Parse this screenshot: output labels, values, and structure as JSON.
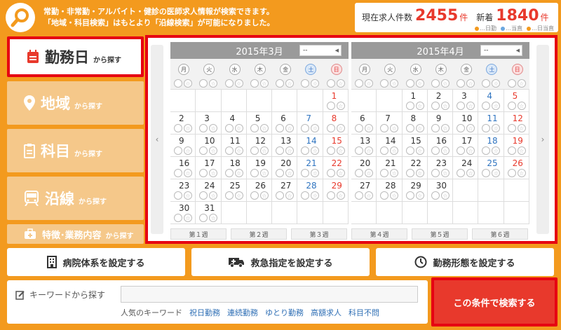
{
  "header": {
    "line1": "常勤・非常勤・アルバイト・健診の医師求人情報が検索できます。",
    "line2": "「地域・科目検索」はもとより「沿線検索」が可能になりました。",
    "total_label": "現在求人件数",
    "total_value": "2455",
    "total_unit": "件",
    "new_label": "新着",
    "new_value": "1840",
    "new_unit": "件",
    "legend": [
      "…日勤",
      "…当直",
      "…日当直"
    ]
  },
  "tabs": [
    {
      "big": "勤務日",
      "small": "から探す",
      "icon": "calendar-icon"
    },
    {
      "big": "地域",
      "small": "から探す",
      "icon": "map-pin-icon"
    },
    {
      "big": "科目",
      "small": "から探す",
      "icon": "clipboard-icon"
    },
    {
      "big": "沿線",
      "small": "から探す",
      "icon": "train-icon"
    },
    {
      "big": "特徴･業務内容",
      "small": "から探す",
      "icon": "briefcase-icon"
    }
  ],
  "calendar": {
    "weekdays": [
      "月",
      "火",
      "水",
      "木",
      "金",
      "土",
      "日"
    ],
    "months": [
      {
        "title": "2015年3月",
        "select": "--",
        "offset": 6,
        "days": 31
      },
      {
        "title": "2015年4月",
        "select": "--",
        "offset": 2,
        "days": 30
      }
    ],
    "weeks_left": [
      "第１週",
      "第２週",
      "第３週"
    ],
    "weeks_right": [
      "第４週",
      "第５週",
      "第６週"
    ]
  },
  "options": [
    {
      "label": "病院体系を設定する",
      "icon": "building-icon"
    },
    {
      "label": "救急指定を設定する",
      "icon": "ambulance-icon"
    },
    {
      "label": "勤務形態を設定する",
      "icon": "clock-icon"
    }
  ],
  "keyword": {
    "label": "キーワードから探す",
    "placeholder": "",
    "popular_label": "人気のキーワード",
    "popular": [
      "祝日勤務",
      "連続勤務",
      "ゆとり勤務",
      "高額求人",
      "科目不問"
    ]
  },
  "search_button": "この条件で検索する",
  "colors": {
    "accent": "#f39a1e",
    "red": "#e60012",
    "sat": "#2f74c0",
    "sun": "#e8392c"
  }
}
